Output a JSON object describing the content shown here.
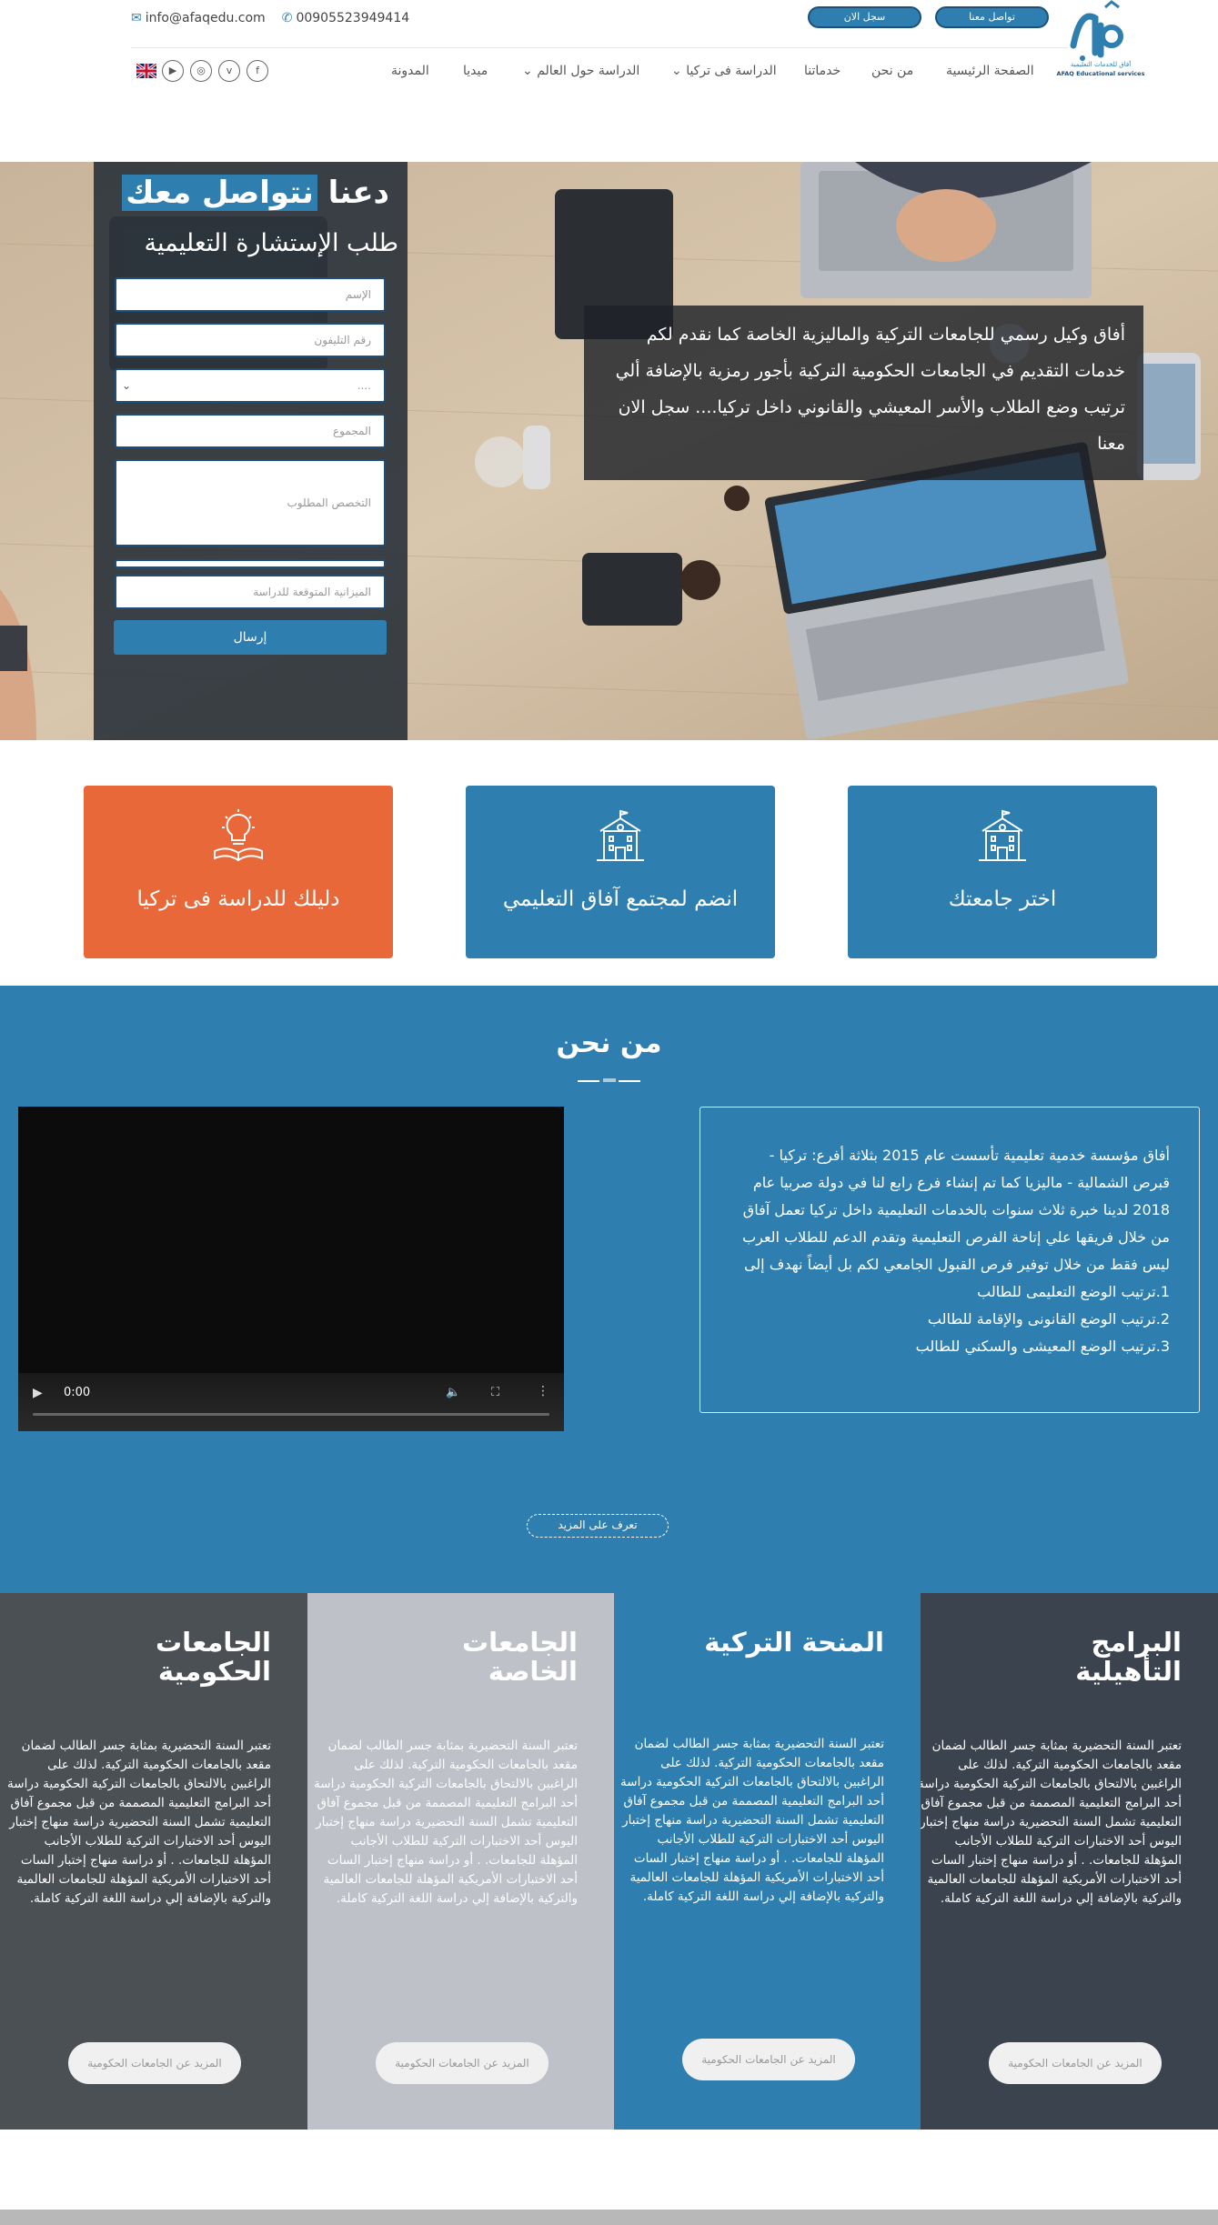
{
  "header": {
    "email": "info@afaqedu.com",
    "phone": "00905523949414",
    "contact_button": "تواصل معنا",
    "register_button": "سجل الان",
    "logo_text_ar": "آفاق",
    "logo_sub_ar": "آفاق للخدمات التعليمية",
    "logo_sub_en": "AFAQ Educational services",
    "nav": [
      {
        "label": "الصفحة الرئيسية"
      },
      {
        "label": "من نحن"
      },
      {
        "label": "خدماتنا"
      },
      {
        "label": "الدراسة فى تركيا",
        "has_dropdown": true
      },
      {
        "label": "الدراسة حول العالم",
        "has_dropdown": true
      },
      {
        "label": "ميديا"
      },
      {
        "label": "المدونة"
      }
    ],
    "social_icons": [
      "facebook-icon",
      "vimeo-icon",
      "instagram-icon",
      "youtube-icon",
      "uk-flag-icon"
    ]
  },
  "hero": {
    "form_title_plain": "دعنا",
    "form_title_highlight": "نتواصل معك",
    "form_subtitle": "طلب الإستشارة التعليمية",
    "fields": {
      "name": "الإسم",
      "phone": "رقم التليفون",
      "select": "....",
      "total": "المجموع",
      "specialty": "التخصص المطلوب",
      "budget": "الميزانية المتوقعة للدراسة"
    },
    "submit": "إرسال",
    "description": "أفاق وكيل رسمي للجامعات التركية والماليزية الخاصة كما نقدم لكم خدمات التقديم في الجامعات الحكومية التركية بأجور رمزية بالإضافة ألي ترتيب وضع الطلاب والأسر المعيشي والقانوني داخل تركيا.... سجل الان معنا"
  },
  "cards": [
    {
      "label": "اختر جامعتك",
      "icon": "building-icon",
      "color": "#2e7fb0"
    },
    {
      "label": "انضم لمجتمع آفاق التعليمي",
      "icon": "building-icon",
      "color": "#2e7fb0"
    },
    {
      "label": "دليلك للدراسة فى تركيا",
      "icon": "lightbulb-book-icon",
      "color": "#e8683a"
    }
  ],
  "about": {
    "title": "من نحن",
    "video_time": "0:00",
    "paragraphs": [
      "أفاق مؤسسة خدمية تعليمية تأسست عام 2015 بثلاثة أفرع: تركيا - قبرص الشمالية - ماليزيا كما تم إنشاء فرع رابع لنا في دولة صربيا عام 2018 لدينا خبرة ثلاث سنوات بالخدمات التعليمية داخل تركيا تعمل آفاق من خلال فريقها علي إتاحة الفرص التعليمية وتقدم الدعم للطلاب العرب ليس فقط من خلال توفير فرص القبول الجامعي لكم بل أيضاً نهدف إلى",
      "1.ترتيب الوضع التعليمى للطالب",
      "2.ترتيب الوضع القانونى والإقامة للطالب",
      "3.ترتيب الوضع المعيشى والسكني للطالب"
    ],
    "more_button": "تعرف على المزيد"
  },
  "columns": [
    {
      "title": "البرامج التأهيلية",
      "color": "#3a434e"
    },
    {
      "title": "المنحة التركية",
      "color": "#2e7fb0"
    },
    {
      "title": "الجامعات الخاصة",
      "color": "#bfc1c8"
    },
    {
      "title": "الجامعات الحكومية",
      "color": "#4b5055"
    }
  ],
  "column_text": "تعتبر السنة التحضيرية بمثابة جسر الطالب لضمان مقعد بالجامعات الحكومية التركية. لذلك على الراغبين بالالتحاق بالجامعات التركية الحكومية دراسة أحد البرامج التعليمية المصممة من قبل مجموع آفاق التعليمية تشمل السنة التحضيرية دراسة منهاج إختبار اليوس أحد الاختبارات التركية للطلاب الأجانب المؤهلة للجامعات. . أو دراسة منهاج إختبار السات أحد الاختبارات الأمريكية المؤهلة للجامعات العالمية والتركية بالإضافة إلي دراسة اللغة التركية كاملة.",
  "column_button": "المزيد عن الجامعات الحكومية"
}
